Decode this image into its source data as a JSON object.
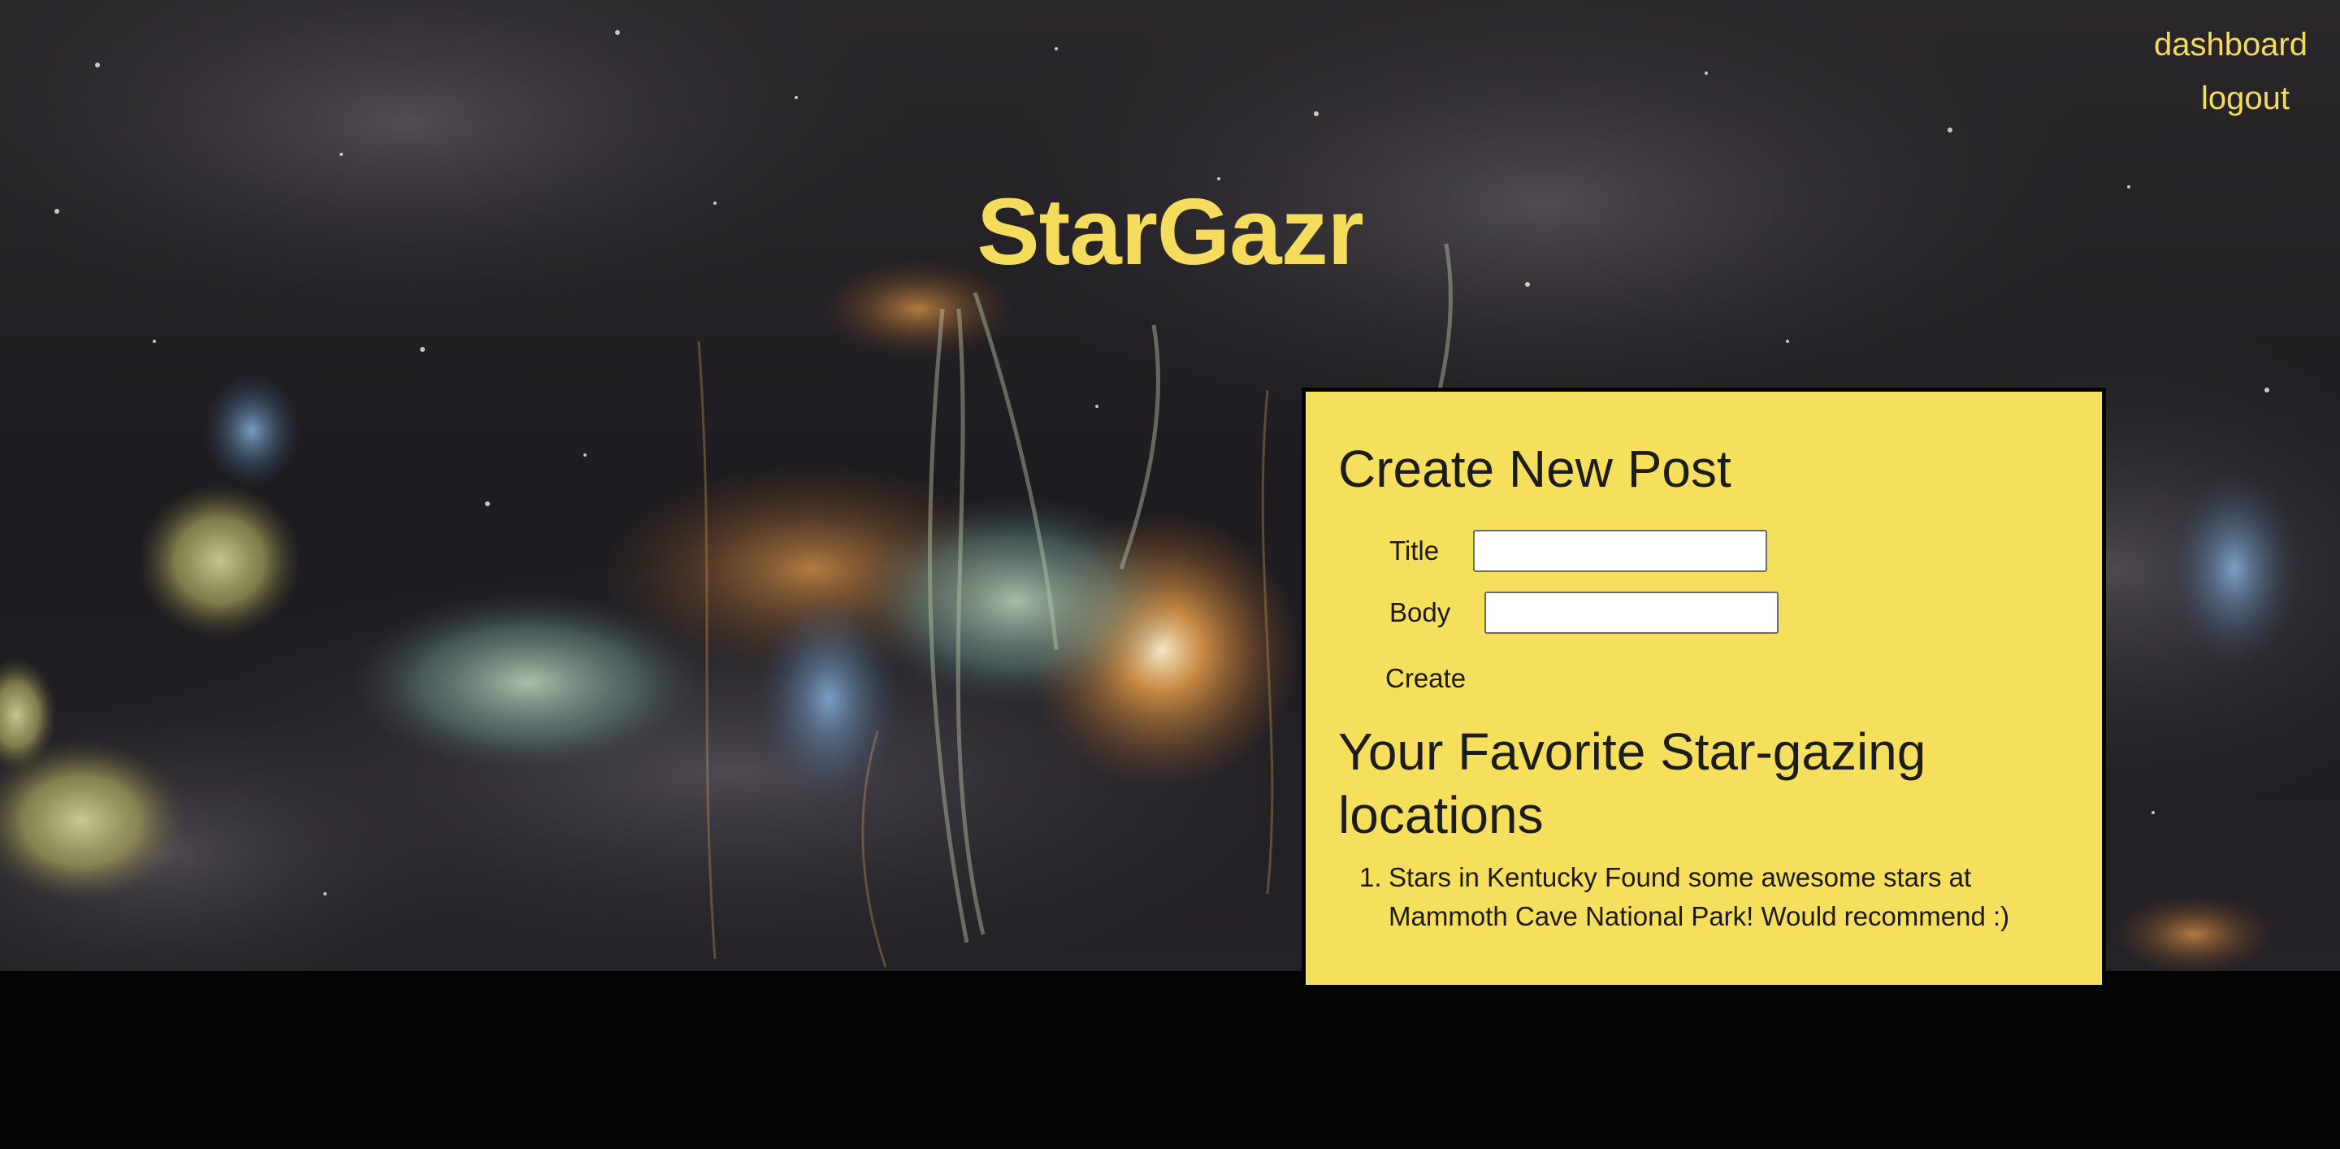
{
  "nav": {
    "dashboard": "dashboard",
    "logout": "logout"
  },
  "site_title": "StarGazr",
  "create_post": {
    "heading": "Create New Post",
    "title_label": "Title",
    "title_value": "",
    "body_label": "Body",
    "body_value": "",
    "submit_label": "Create"
  },
  "favorites": {
    "heading": "Your Favorite Star-gazing locations",
    "posts": [
      {
        "number": "1.",
        "title": "Stars in Kentucky",
        "body": "Found some awesome stars at Mammoth Cave National Park! Would recommend :)"
      }
    ]
  },
  "colors": {
    "accent_yellow": "#f7df5e",
    "title_yellow": "#f5dc5c",
    "footer_black": "#050505"
  }
}
